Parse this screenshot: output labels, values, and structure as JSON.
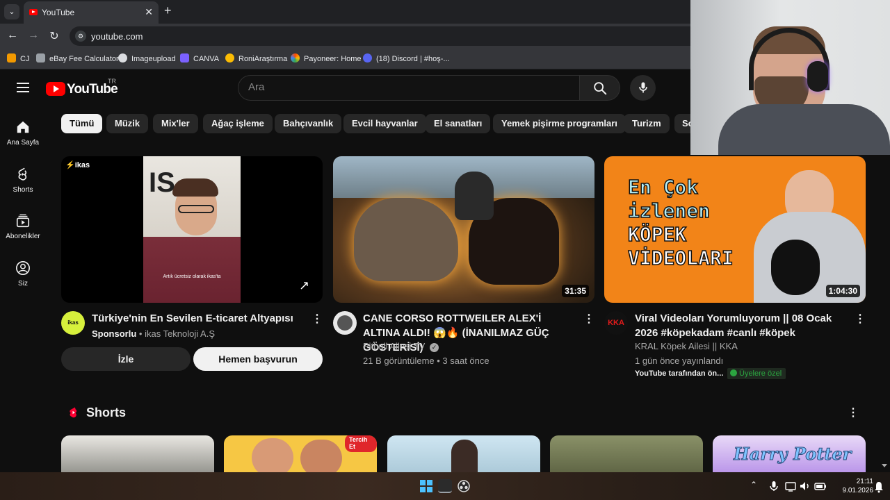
{
  "browser": {
    "tab_title": "YouTube",
    "url": "youtube.com",
    "bookmarks": [
      {
        "label": "CJ",
        "color": "#f29900"
      },
      {
        "label": "eBay Fee Calculator",
        "color": "#9aa0a6"
      },
      {
        "label": "Imageupload",
        "color": "#dadce0"
      },
      {
        "label": "CANVA",
        "color": "#7b61ff"
      },
      {
        "label": "RoniAraştırma",
        "color": "#fbbc04"
      },
      {
        "label": "Payoneer: Home",
        "color": "#ff4800"
      },
      {
        "label": "(18) Discord | #hoş-...",
        "color": "#5865f2"
      }
    ]
  },
  "youtube": {
    "logo_text": "YouTube",
    "country_code": "TR",
    "search_placeholder": "Ara",
    "sidebar": [
      {
        "label": "Ana Sayfa",
        "icon": "home-icon"
      },
      {
        "label": "Shorts",
        "icon": "shorts-icon"
      },
      {
        "label": "Abonelikler",
        "icon": "subscriptions-icon"
      },
      {
        "label": "Siz",
        "icon": "you-icon"
      }
    ],
    "chips": [
      "Tümü",
      "Müzik",
      "Mix'ler",
      "Ağaç işleme",
      "Bahçıvanlık",
      "Evcil hayvanlar",
      "El sanatları",
      "Yemek pişirme programları",
      "Turizm",
      "So"
    ],
    "videos": [
      {
        "title": "Türkiye'nin En Sevilen E-ticaret Altyapısı",
        "sponsor_label": "Sponsorlu",
        "advertiser": "ikas Teknoloji A.Ş",
        "brand": "ikas",
        "thumb_caption": "Artık ücretsiz olarak ikas'ta",
        "watch_button": "İzle",
        "apply_button": "Hemen başvurun"
      },
      {
        "title": "CANE CORSO ROTTWEILER ALEX'İ ALTINA ALDI! 😱🔥 (İNANILMAZ GÜÇ GÖSTERİSİ)",
        "channel": "Pitbull Ailesi TV",
        "stats": "21 B görüntüleme • 3 saat önce",
        "duration": "31:35"
      },
      {
        "title": "Viral Videoları Yorumluyorum || 08 Ocak 2026 #köpekadam #canlı #köpek",
        "channel": "KRAL Köpek Ailesi || KKA",
        "stats": "1 gün önce yayınlandı",
        "extra": "YouTube tarafından ön...",
        "members_badge": "Üyelere özel",
        "duration": "1:04:30",
        "thumb_text": [
          "En Çok",
          "izlenen",
          "KÖPEK",
          "VİDEOLARI"
        ],
        "avatar_text": "KKA"
      }
    ],
    "shorts_title": "Shorts",
    "shorts_thumb_text": [
      "Tercih Et",
      "Harry Potter"
    ]
  },
  "taskbar": {
    "time": "21:11",
    "date": "9.01.2026"
  }
}
